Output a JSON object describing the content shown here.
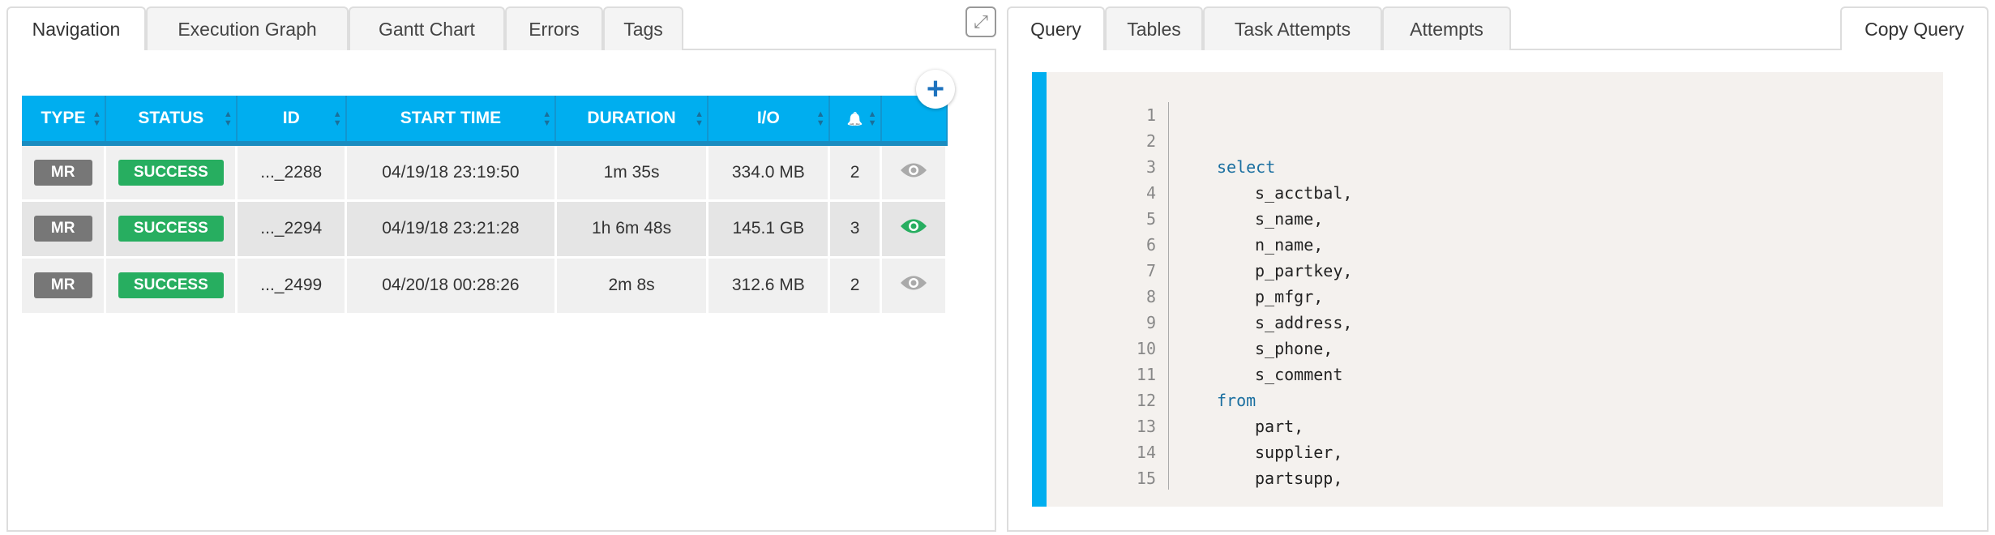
{
  "left_panel": {
    "tabs": [
      {
        "label": "Navigation",
        "active": true
      },
      {
        "label": "Execution Graph"
      },
      {
        "label": "Gantt Chart"
      },
      {
        "label": "Errors"
      },
      {
        "label": "Tags"
      }
    ],
    "columns": [
      "TYPE",
      "STATUS",
      "ID",
      "START TIME",
      "DURATION",
      "I/O"
    ],
    "alerts_icon": "bell-icon",
    "rows": [
      {
        "type": "MR",
        "status": "SUCCESS",
        "id": "..._2288",
        "start": "04/19/18 23:19:50",
        "duration": "1m 35s",
        "io": "334.0 MB",
        "alerts": "2",
        "selected": false
      },
      {
        "type": "MR",
        "status": "SUCCESS",
        "id": "..._2294",
        "start": "04/19/18 23:21:28",
        "duration": "1h 6m 48s",
        "io": "145.1 GB",
        "alerts": "3",
        "selected": true
      },
      {
        "type": "MR",
        "status": "SUCCESS",
        "id": "..._2499",
        "start": "04/20/18 00:28:26",
        "duration": "2m 8s",
        "io": "312.6 MB",
        "alerts": "2",
        "selected": false
      }
    ]
  },
  "right_panel": {
    "tabs": [
      {
        "label": "Query",
        "active": true
      },
      {
        "label": "Tables"
      },
      {
        "label": "Task Attempts"
      },
      {
        "label": "Attempts"
      }
    ],
    "copy_label": "Copy Query",
    "code": [
      {
        "n": "1",
        "t": "",
        "i": 0
      },
      {
        "n": "2",
        "t": "",
        "i": 0
      },
      {
        "n": "3",
        "t": "select",
        "i": 0,
        "kw": true
      },
      {
        "n": "4",
        "t": "s_acctbal,",
        "i": 1
      },
      {
        "n": "5",
        "t": "s_name,",
        "i": 1
      },
      {
        "n": "6",
        "t": "n_name,",
        "i": 1
      },
      {
        "n": "7",
        "t": "p_partkey,",
        "i": 1
      },
      {
        "n": "8",
        "t": "p_mfgr,",
        "i": 1
      },
      {
        "n": "9",
        "t": "s_address,",
        "i": 1
      },
      {
        "n": "10",
        "t": "s_phone,",
        "i": 1
      },
      {
        "n": "11",
        "t": "s_comment",
        "i": 1
      },
      {
        "n": "12",
        "t": "from",
        "i": 0,
        "kw": true
      },
      {
        "n": "13",
        "t": "part,",
        "i": 1
      },
      {
        "n": "14",
        "t": "supplier,",
        "i": 1
      },
      {
        "n": "15",
        "t": "partsupp,",
        "i": 1
      }
    ]
  },
  "colors": {
    "header": "#00aeef",
    "success": "#27ae60",
    "selected_eye": "#27ae60",
    "eye": "#aaaaaa",
    "keyword": "#1a6fa0"
  }
}
